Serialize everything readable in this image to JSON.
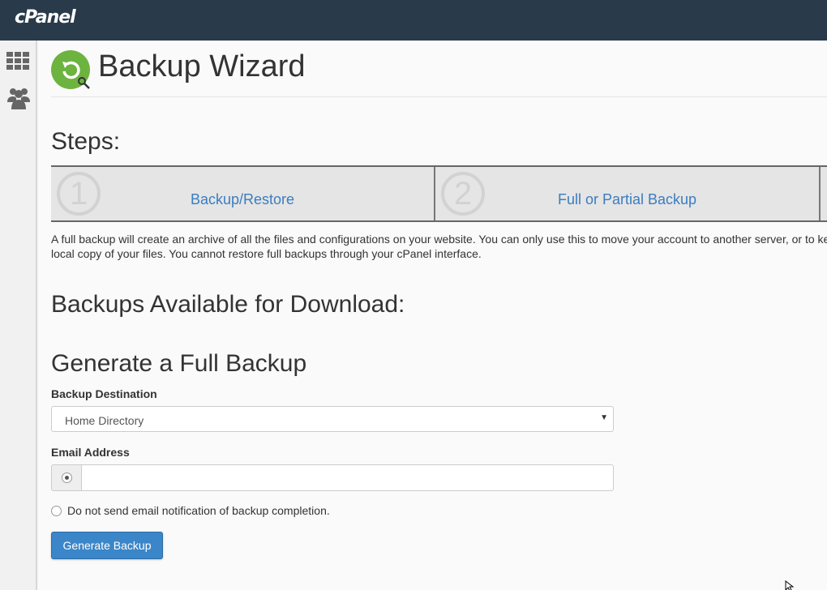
{
  "brand": {
    "logo_text": "cPanel"
  },
  "sidebar": {
    "items": [
      {
        "icon": "grid-icon",
        "interactable": true
      },
      {
        "icon": "users-icon",
        "interactable": true
      }
    ]
  },
  "header": {
    "title": "Backup Wizard",
    "icon": "backup-wizard-icon"
  },
  "steps": {
    "heading": "Steps:",
    "items": [
      {
        "number": "1",
        "label": "Backup/Restore"
      },
      {
        "number": "2",
        "label": "Full or Partial Backup"
      }
    ],
    "description": "A full backup will create an archive of all the files and configurations on your website. You can only use this to move your account to another server, or to keep a local copy of your files. You cannot restore full backups through your cPanel interface."
  },
  "sections": {
    "available_heading": "Backups Available for Download:",
    "generate_heading": "Generate a Full Backup"
  },
  "form": {
    "destination_label": "Backup Destination",
    "destination_value": "Home Directory",
    "email_label": "Email Address",
    "email_value": "",
    "no_notify_label": "Do not send email notification of backup completion.",
    "submit_label": "Generate Backup"
  },
  "colors": {
    "topbar": "#293a4a",
    "link": "#3a7dc1",
    "button": "#3b86c9",
    "icon_green": "#6db33f"
  }
}
